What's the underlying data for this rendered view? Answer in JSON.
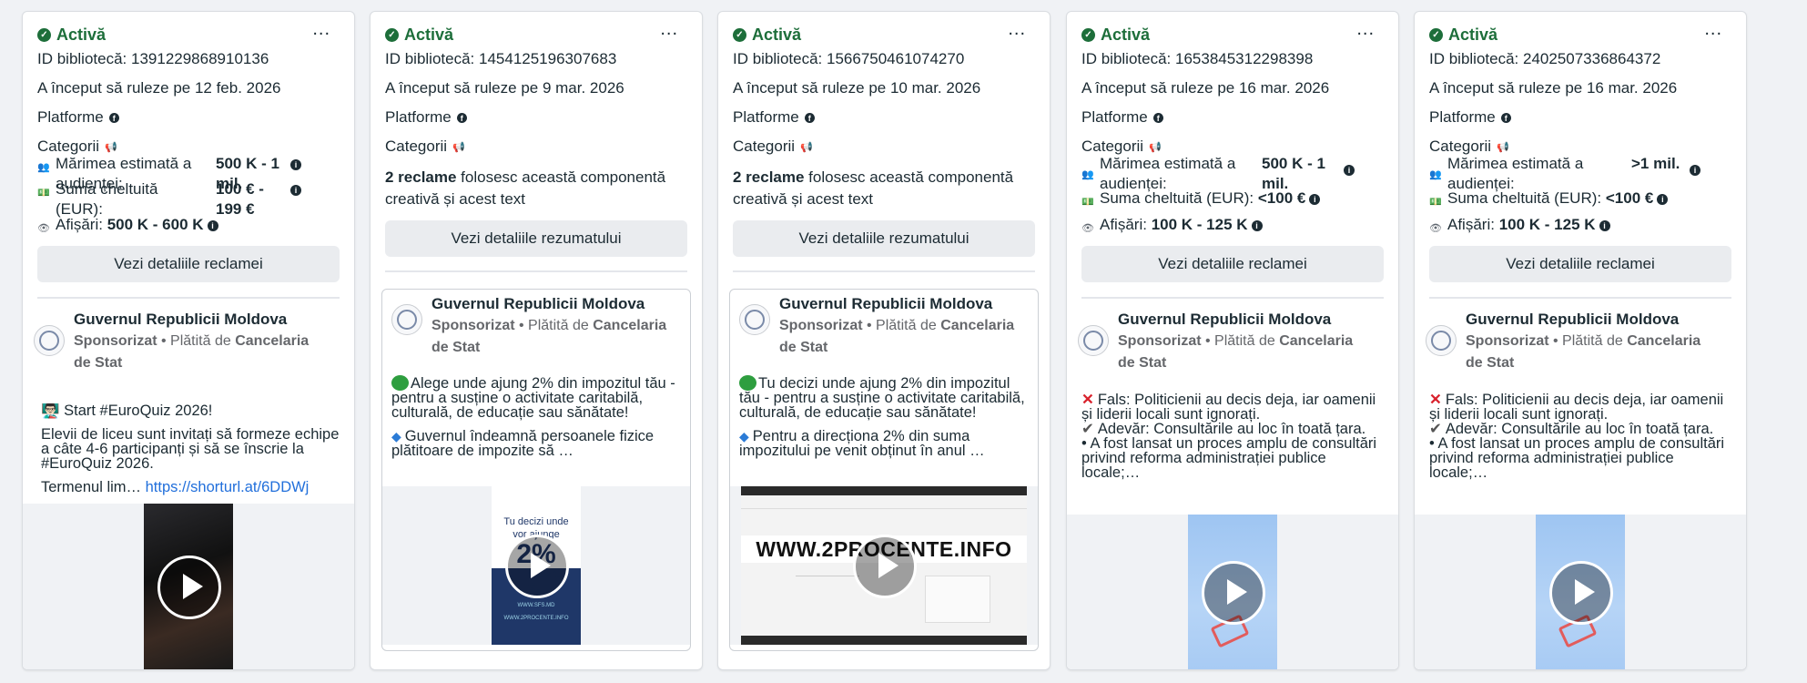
{
  "common": {
    "status": "Activă",
    "more": "...",
    "platforms": "Platforme",
    "categories": "Categorii",
    "audience_label": "Mărimea estimată a audienței:",
    "spend_label_split": "Suma cheltuită (EUR):",
    "spend_label": "Suma cheltuită (EUR):",
    "impressions_label": "Afișări:",
    "details_button": "Vezi detaliile reclamei",
    "summary_button": "Vezi detaliile rezumatului",
    "page_name": "Guvernul Republicii Moldova",
    "sponsored": "Sponsorizat",
    "paid_by": " • Plătită de ",
    "payer": "Cancelaria de Stat",
    "ads_count_bold": "2 reclame",
    "ads_count_rest": " folosesc această componentă creativă și acest text",
    "icons": {
      "check": "check-circle-icon",
      "more": "more-options-icon",
      "facebook": "facebook-icon",
      "megaphone": "megaphone-icon",
      "audience": "people-icon",
      "spend": "money-icon",
      "impressions": "eye-icon",
      "info": "info-icon",
      "play": "play-icon"
    }
  },
  "cards": [
    {
      "library_id": "ID bibliotecă: 1391229868910136",
      "started": "A început să ruleze pe 12 feb. 2026",
      "audience": "500 K - 1 mil.",
      "spend": "100 € - 199 €",
      "impressions": "500 K - 600 K",
      "text1": "👨🏻‍🏫 Start #EuroQuiz 2026!",
      "text2": "Elevii de liceu sunt invitați să formeze echipe a câte 4-6 participanți și să se înscrie la #EuroQuiz 2026.",
      "text3": "Termenul lim…",
      "link": "https://shorturl.at/6DDWj"
    },
    {
      "library_id": "ID bibliotecă: 1454125196307683",
      "started": "A început să ruleze pe 9 mar. 2026",
      "text1": "Alege unde ajung 2% din impozitul tău - pentru a susține o activitate caritabilă, culturală, de educație sau sănătate!",
      "text2": "Guvernul îndeamnă persoanele fizice plătitoare de impozite să …",
      "poster": [
        "Tu decizi unde",
        "vor ajunge",
        "2%",
        "din impozitul",
        "tău!",
        "WWW.SFS.MD",
        "WWW.2PROCENTE.INFO"
      ]
    },
    {
      "library_id": "ID bibliotecă: 1566750461074270",
      "started": "A început să ruleze pe 10 mar. 2026",
      "text1": "Tu decizi unde ajung 2% din impozitul tău - pentru a susține o activitate caritabilă, culturală, de educație sau sănătate!",
      "text2": "Pentru a direcționa 2% din suma impozitului pe venit obținut în anul …",
      "banner": "WWW.2PROCENTE.INFO"
    },
    {
      "library_id": "ID bibliotecă: 1653845312298398",
      "started": "A început să ruleze pe 16 mar. 2026",
      "audience": "500 K - 1 mil.",
      "spend": "<100 €",
      "impressions": "100 K - 125 K",
      "text1": "Fals: Politicienii au decis deja, iar oamenii și liderii locali sunt ignorați.",
      "text2": "Adevăr: Consultările au loc în toată țara.",
      "text3": "• A fost lansat un proces amplu de consultări privind reforma administrației publice locale;…"
    },
    {
      "library_id": "ID bibliotecă: 2402507336864372",
      "started": "A început să ruleze pe 16 mar. 2026",
      "audience": ">1 mil.",
      "spend": "<100 €",
      "impressions": "100 K - 125 K",
      "text1": "Fals: Politicienii au decis deja, iar oamenii și liderii locali sunt ignorați.",
      "text2": "Adevăr: Consultările au loc în toată țara.",
      "text3": "• A fost lansat un proces amplu de consultări privind reforma administrației publice locale;…"
    }
  ]
}
